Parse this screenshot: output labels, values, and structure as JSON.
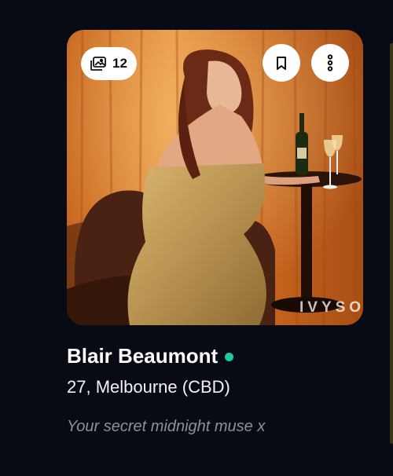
{
  "card": {
    "photo_count": "12",
    "watermark": "IVYSO",
    "name": "Blair Beaumont",
    "online": true,
    "details": "27, Melbourne (CBD)",
    "tagline": "Your secret midnight muse x"
  },
  "icons": {
    "gallery": "gallery-icon",
    "bookmark": "bookmark-icon",
    "more": "more-vertical-icon"
  },
  "colors": {
    "background": "#080a14",
    "online_dot": "#1fc7a2",
    "tagline": "#8e909a"
  }
}
